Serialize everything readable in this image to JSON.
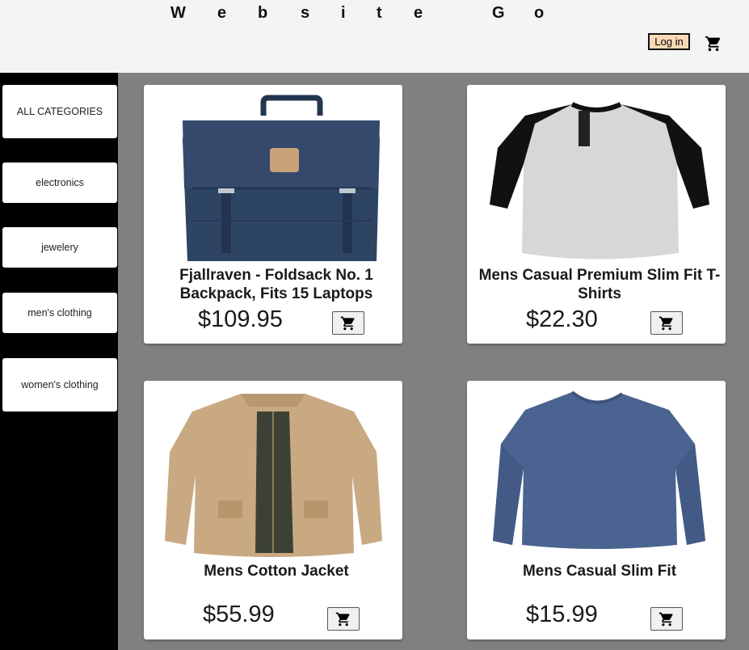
{
  "header": {
    "title_chars": [
      "W",
      "e",
      "b",
      "s",
      "i",
      "t",
      "e",
      "G",
      "o"
    ],
    "login_label": "Log in",
    "cart_icon": "shopping-cart-icon"
  },
  "sidebar": {
    "categories": [
      {
        "label": "ALL CATEGORIES"
      },
      {
        "label": "electronics"
      },
      {
        "label": "jewelery"
      },
      {
        "label": "men's clothing"
      },
      {
        "label": "women's clothing"
      }
    ]
  },
  "products": [
    {
      "title": "Fjallraven - Foldsack No. 1 Backpack, Fits 15 Laptops",
      "price": "$109.95",
      "image": "backpack"
    },
    {
      "title": "Mens Casual Premium Slim Fit T-Shirts",
      "price": "$22.30",
      "image": "raglan-shirt"
    },
    {
      "title": "Mens Cotton Jacket",
      "price": "$55.99",
      "image": "jacket"
    },
    {
      "title": "Mens Casual Slim Fit",
      "price": "$15.99",
      "image": "long-sleeve-shirt"
    }
  ],
  "colors": {
    "header_bg": "#f4f4f4",
    "content_bg": "#808080",
    "sidebar_bg": "#000000",
    "login_bg": "#f8d9b5"
  }
}
